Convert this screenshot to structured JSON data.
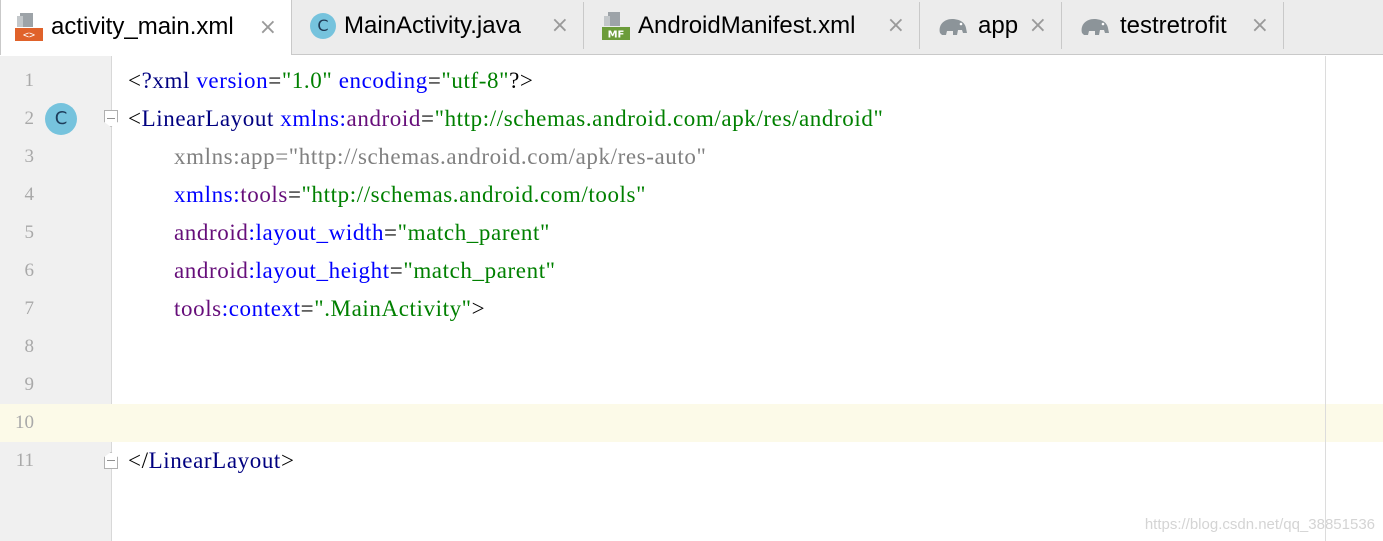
{
  "tabs": [
    {
      "label": "activity_main.xml",
      "icon": "xml-layout-file-icon",
      "active": true
    },
    {
      "label": "MainActivity.java",
      "icon": "java-class-icon",
      "icon_letter": "C"
    },
    {
      "label": "AndroidManifest.xml",
      "icon": "manifest-file-icon",
      "icon_badge": "MF"
    },
    {
      "label": "app",
      "icon": "gradle-elephant-icon"
    },
    {
      "label": "testretrofit",
      "icon": "gradle-elephant-icon"
    }
  ],
  "close_glyph": "×",
  "gutter": {
    "class_marker_letter": "C"
  },
  "lines": [
    {
      "n": "1",
      "segments": [
        [
          "punct",
          "<"
        ],
        [
          "tag",
          "?xml"
        ],
        [
          "attr",
          " version"
        ],
        [
          "punct",
          "="
        ],
        [
          "val",
          "\"1.0\""
        ],
        [
          "attr",
          " encoding"
        ],
        [
          "punct",
          "="
        ],
        [
          "val",
          "\"utf-8\""
        ],
        [
          "punct",
          "?>"
        ]
      ]
    },
    {
      "n": "2",
      "segments": [
        [
          "punct",
          "<"
        ],
        [
          "tag",
          "LinearLayout"
        ],
        [
          "attr",
          " xmlns:"
        ],
        [
          "attrns",
          "android"
        ],
        [
          "punct",
          "="
        ],
        [
          "val",
          "\"http://schemas.android.com/apk/res/android\""
        ]
      ]
    },
    {
      "n": "3",
      "segments": [
        [
          "gray",
          "xmlns:app=\"http://schemas.android.com/apk/res-auto\""
        ]
      ]
    },
    {
      "n": "4",
      "segments": [
        [
          "attr",
          "xmlns:"
        ],
        [
          "attrns",
          "tools"
        ],
        [
          "punct",
          "="
        ],
        [
          "val",
          "\"http://schemas.android.com/tools\""
        ]
      ]
    },
    {
      "n": "5",
      "segments": [
        [
          "attrns",
          "android"
        ],
        [
          "attr",
          ":layout_width"
        ],
        [
          "punct",
          "="
        ],
        [
          "val",
          "\"match_parent\""
        ]
      ]
    },
    {
      "n": "6",
      "segments": [
        [
          "attrns",
          "android"
        ],
        [
          "attr",
          ":layout_height"
        ],
        [
          "punct",
          "="
        ],
        [
          "val",
          "\"match_parent\""
        ]
      ]
    },
    {
      "n": "7",
      "segments": [
        [
          "attrns",
          "tools"
        ],
        [
          "attr",
          ":context"
        ],
        [
          "punct",
          "="
        ],
        [
          "val",
          "\".MainActivity\""
        ],
        [
          "punct",
          ">"
        ]
      ]
    },
    {
      "n": "8",
      "segments": []
    },
    {
      "n": "9",
      "segments": []
    },
    {
      "n": "10",
      "segments": [],
      "current": true
    },
    {
      "n": "11",
      "segments": [
        [
          "punct",
          "</"
        ],
        [
          "tag",
          "LinearLayout"
        ],
        [
          "punct",
          ">"
        ]
      ]
    }
  ],
  "watermark": "https://blog.csdn.net/qq_38851536",
  "colors": {
    "tag": "#000080",
    "attr": "#0000ff",
    "namespace": "#660e7a",
    "value": "#008000",
    "current_line": "#fcfae8"
  }
}
